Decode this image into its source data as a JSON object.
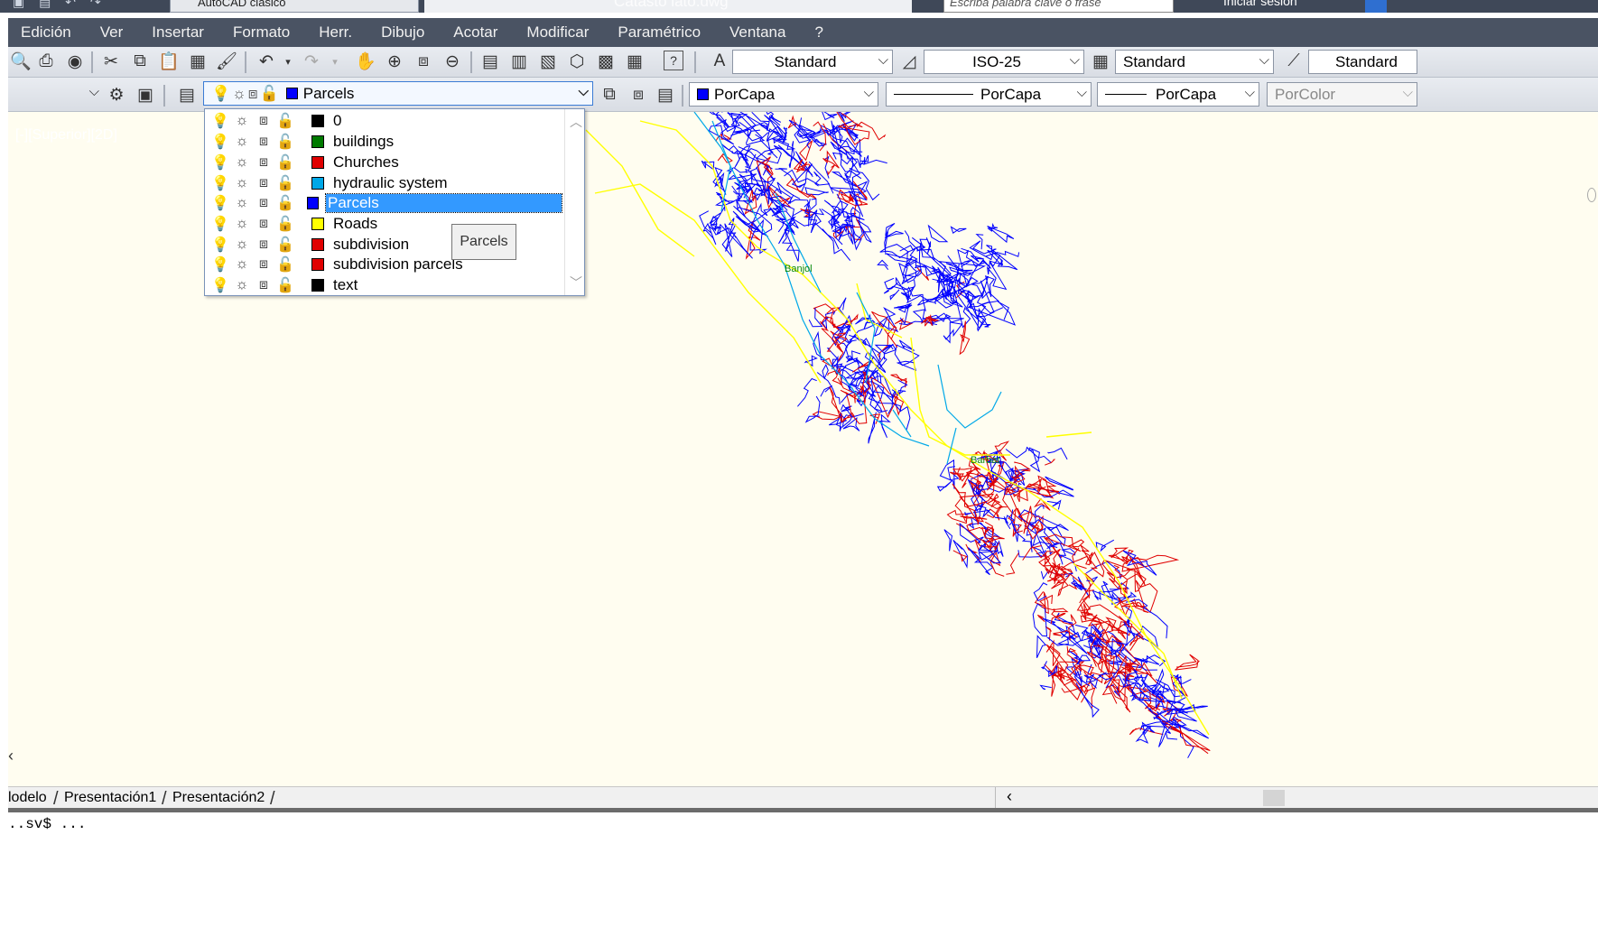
{
  "titlebar": {
    "workspace": "AutoCAD clásico",
    "document": "Catasto lato.dwg",
    "search_placeholder": "Escriba palabra clave o frase",
    "signin": "Iniciar sesión"
  },
  "menu": [
    "Edición",
    "Ver",
    "Insertar",
    "Formato",
    "Herr.",
    "Dibujo",
    "Acotar",
    "Modificar",
    "Paramétrico",
    "Ventana",
    "?"
  ],
  "styles_toolbar": {
    "text_style": "Standard",
    "dim_style": "ISO-25",
    "table_style": "Standard",
    "multileader_style": "Standard"
  },
  "layers_toolbar": {
    "current_layer": "Parcels",
    "current_layer_color": "#0000ff"
  },
  "properties_toolbar": {
    "color": "PorCapa",
    "linetype": "PorCapa",
    "lineweight": "PorCapa",
    "plotstyle": "PorColor"
  },
  "layer_dropdown": {
    "items": [
      {
        "name": "0",
        "color": "#000000"
      },
      {
        "name": "buildings",
        "color": "#007a00"
      },
      {
        "name": "Churches",
        "color": "#e00000"
      },
      {
        "name": "hydraulic system",
        "color": "#00a8e8"
      },
      {
        "name": "Parcels",
        "color": "#0000ff"
      },
      {
        "name": "Roads",
        "color": "#ffff00"
      },
      {
        "name": "subdivision",
        "color": "#e00000"
      },
      {
        "name": "subdivision parcels",
        "color": "#e00000"
      },
      {
        "name": "text",
        "color": "#000000"
      }
    ],
    "selected_index": 4,
    "tooltip": "Parcels"
  },
  "drawing": {
    "view_label": "[-][Superior][2D]",
    "place_names": [
      "Banjol",
      "Barbat"
    ],
    "colors": {
      "parcels": "#0000ff",
      "roads": "#ffff00",
      "hydro": "#00a8e8",
      "subdivision": "#e00000",
      "background": "#fffdf0"
    }
  },
  "tabs": [
    "lodelo",
    "Presentación1",
    "Presentación2"
  ],
  "command_line": "..sv$ ..."
}
